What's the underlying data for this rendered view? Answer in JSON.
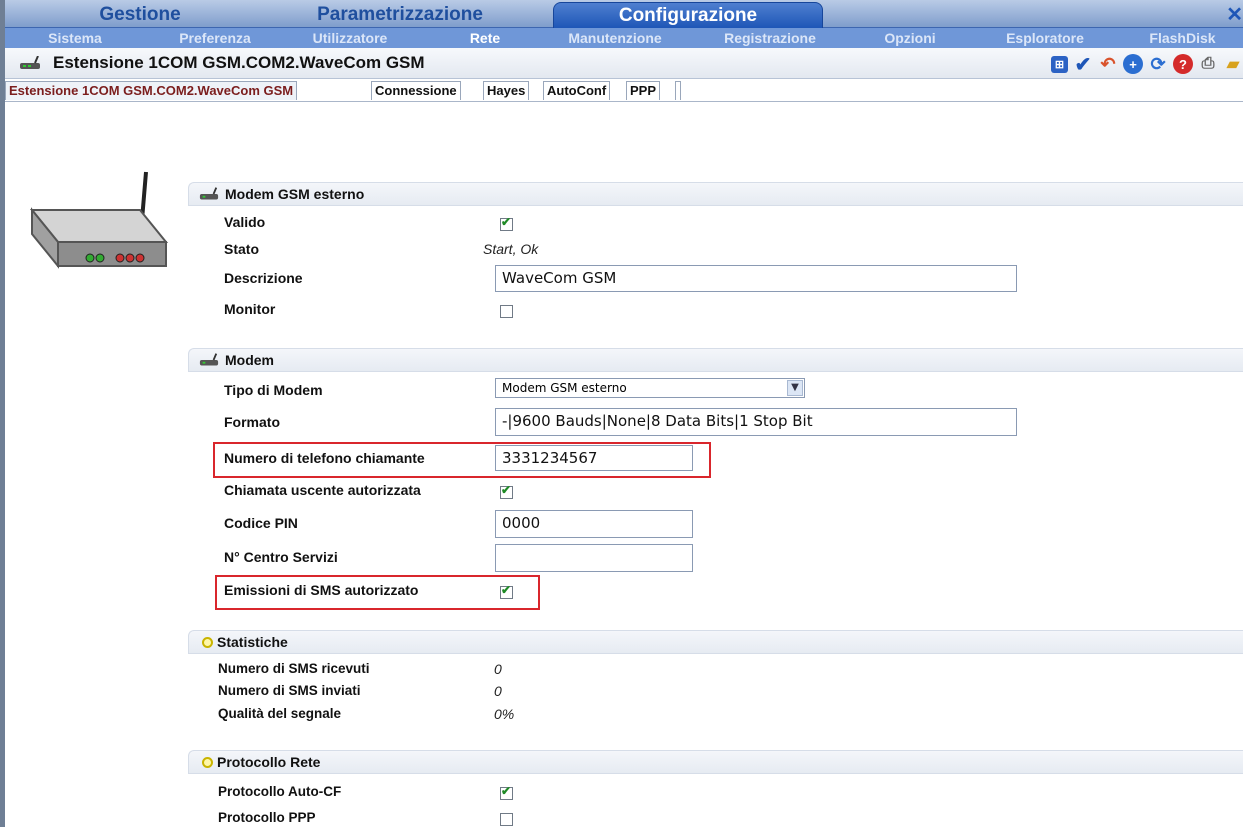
{
  "top_tabs": [
    {
      "label": "Gestione"
    },
    {
      "label": "Parametrizzazione"
    },
    {
      "label": "Configurazione"
    }
  ],
  "sub_nav": [
    {
      "label": "Sistema"
    },
    {
      "label": "Preferenza"
    },
    {
      "label": "Utilizzatore"
    },
    {
      "label": "Rete"
    },
    {
      "label": "Manutenzione"
    },
    {
      "label": "Registrazione"
    },
    {
      "label": "Opzioni"
    },
    {
      "label": "Esploratore"
    },
    {
      "label": "FlashDisk"
    }
  ],
  "header": {
    "title": "Estensione 1COM GSM.COM2.WaveCom GSM"
  },
  "toolbar_icons": [
    "grid-icon",
    "check-icon",
    "undo-icon",
    "add-icon",
    "refresh-icon",
    "help-icon",
    "print-icon",
    "folder-icon"
  ],
  "page_tabs": [
    {
      "label": "Estensione 1COM GSM.COM2.WaveCom GSM"
    },
    {
      "label": "Connessione"
    },
    {
      "label": "Hayes"
    },
    {
      "label": "AutoConf"
    },
    {
      "label": "PPP"
    }
  ],
  "sections": {
    "modem_gsm": {
      "title": "Modem GSM esterno",
      "valido_label": "Valido",
      "valido_checked": true,
      "stato_label": "Stato",
      "stato_value": "Start, Ok",
      "descrizione_label": "Descrizione",
      "descrizione_value": "WaveCom GSM",
      "monitor_label": "Monitor",
      "monitor_checked": false
    },
    "modem": {
      "title": "Modem",
      "tipo_label": "Tipo di Modem",
      "tipo_value": "Modem GSM esterno",
      "formato_label": "Formato",
      "formato_value": "-|9600 Bauds|None|8 Data Bits|1 Stop Bit",
      "numero_label": "Numero di telefono chiamante",
      "numero_value": "3331234567",
      "chiamata_label": "Chiamata uscente autorizzata",
      "chiamata_checked": true,
      "pin_label": "Codice PIN",
      "pin_value": "0000",
      "centro_label": "N° Centro Servizi",
      "centro_value": "",
      "sms_label": "Emissioni di SMS autorizzato",
      "sms_checked": true
    },
    "statistiche": {
      "title": "Statistiche",
      "ricevuti_label": "Numero di SMS ricevuti",
      "ricevuti_value": "0",
      "inviati_label": "Numero di SMS inviati",
      "inviati_value": "0",
      "qualita_label": "Qualità del segnale",
      "qualita_value": "0%"
    },
    "protocollo": {
      "title": "Protocollo Rete",
      "autocf_label": "Protocollo Auto-CF",
      "autocf_checked": true,
      "ppp_label": "Protocollo PPP",
      "ppp_checked": false
    }
  },
  "colors": {
    "accent": "#1e56b7",
    "highlight": "#d9262c"
  }
}
